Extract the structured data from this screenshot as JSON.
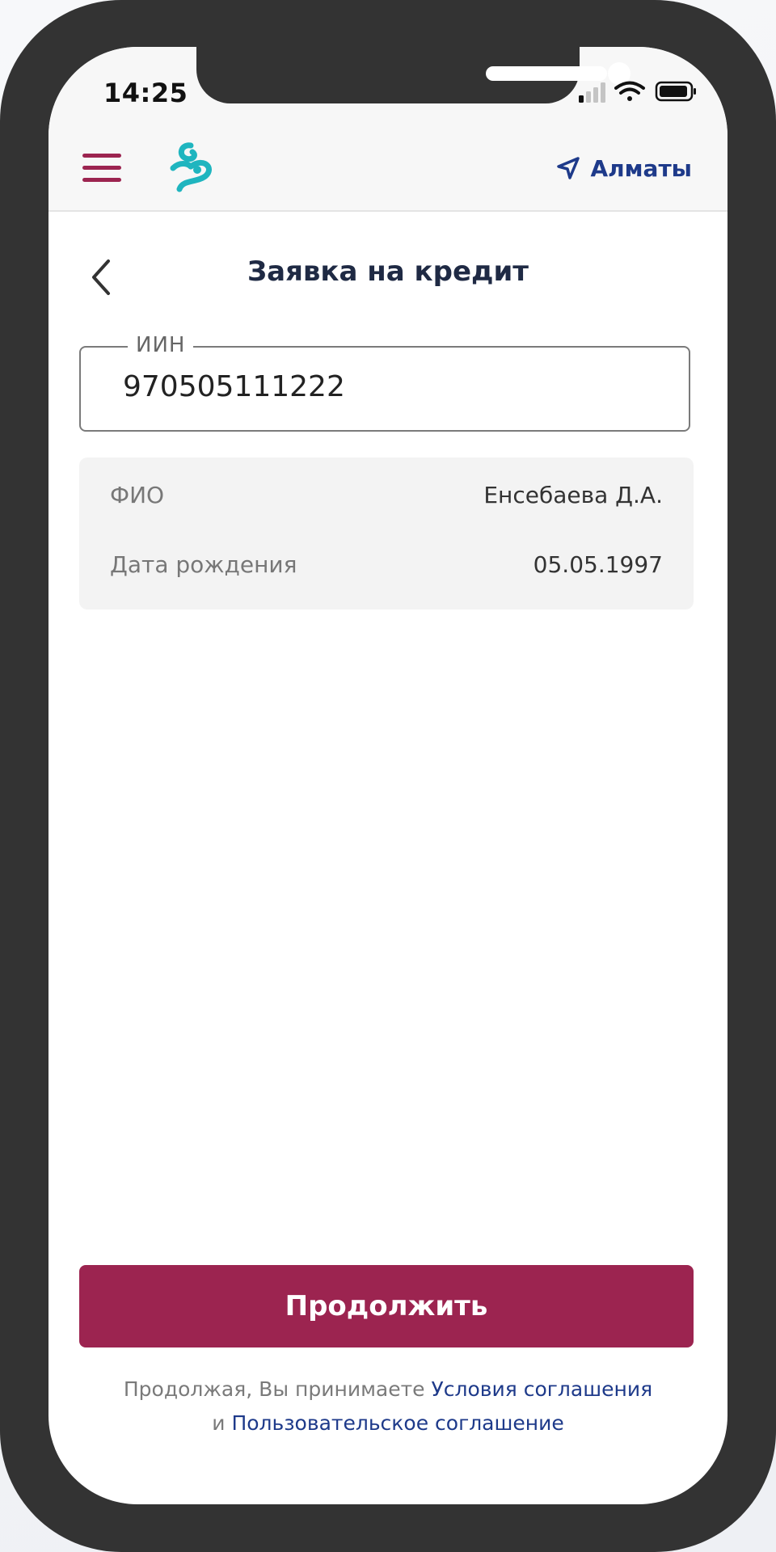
{
  "status_bar": {
    "time": "14:25"
  },
  "header": {
    "menu_icon": "hamburger-menu-icon",
    "logo_icon": "swirl-logo-icon",
    "location_icon": "location-arrow-icon",
    "location_label": "Алматы",
    "accent_color": "#9c2450",
    "logo_color": "#1fb5bf",
    "link_color": "#1e3a8a"
  },
  "page": {
    "back_icon": "chevron-left-icon",
    "title": "Заявка на кредит"
  },
  "iin_field": {
    "label": "ИИН",
    "value": "970505111222"
  },
  "info": {
    "rows": [
      {
        "key": "ФИО",
        "value": "Енсебаева Д.А."
      },
      {
        "key": "Дата рождения",
        "value": "05.05.1997"
      }
    ]
  },
  "actions": {
    "continue_label": "Продолжить"
  },
  "footer": {
    "prefix": "Продолжая, Вы принимаете",
    "terms_link": "Условия соглашения",
    "conjunction": "и",
    "user_agreement_link": "Пользовательское соглашение"
  }
}
